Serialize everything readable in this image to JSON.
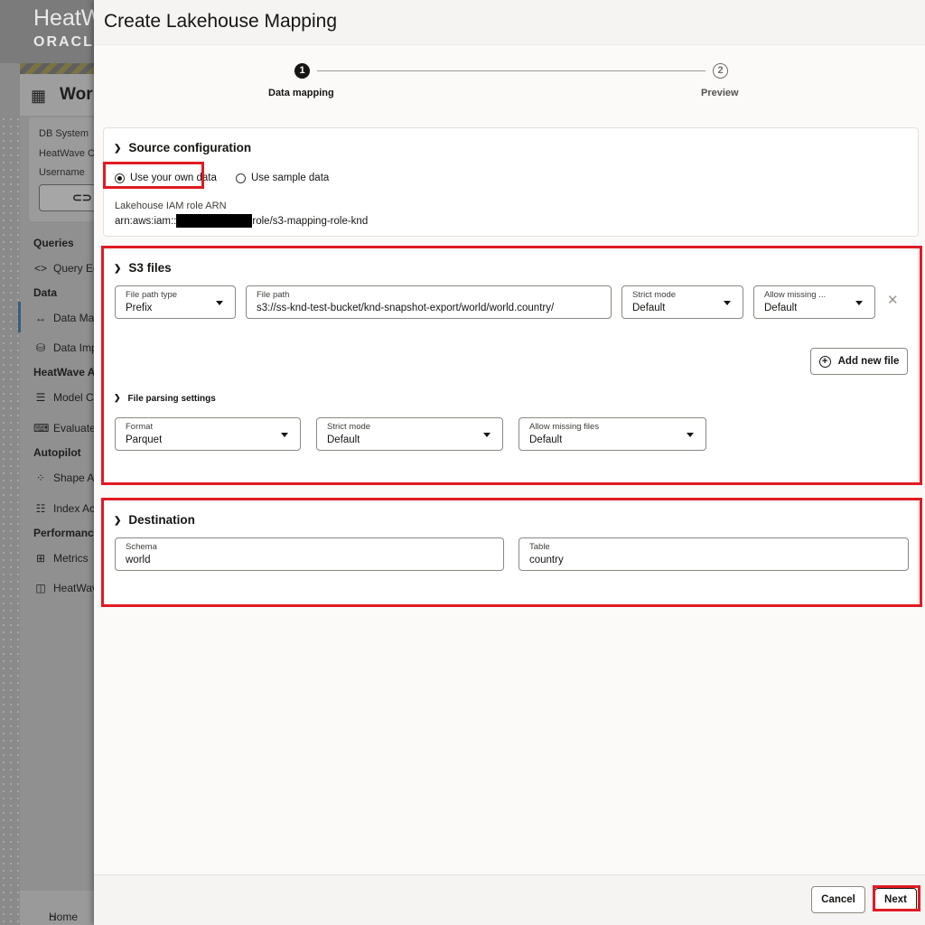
{
  "background_app": {
    "brand_line1": "HeatW",
    "brand_line2": "ORACL",
    "page_title": "Wor",
    "info_labels": [
      "DB System",
      "HeatWave C",
      "Username"
    ],
    "nav": [
      {
        "label": "Queries",
        "section": true
      },
      {
        "label": "Query Ed",
        "icon": "<>"
      },
      {
        "label": "Data",
        "section": true
      },
      {
        "label": "Data Ma",
        "icon": "↔"
      },
      {
        "label": "Data Imp",
        "icon": "⛁"
      },
      {
        "label": "HeatWave A",
        "section": true
      },
      {
        "label": "Model C",
        "icon": "☰"
      },
      {
        "label": "Evaluate",
        "icon": "⌨"
      },
      {
        "label": "Autopilot",
        "section": true
      },
      {
        "label": "Shape A",
        "icon": "⁘"
      },
      {
        "label": "Index Ac",
        "icon": "☷"
      },
      {
        "label": "Performance",
        "section": true
      },
      {
        "label": "Metrics",
        "icon": "⊞"
      },
      {
        "label": "HeatWav",
        "icon": "◫"
      }
    ],
    "home": "Home"
  },
  "drawer": {
    "title": "Create Lakehouse Mapping",
    "steps": [
      {
        "number": "1",
        "label": "Data mapping",
        "active": true
      },
      {
        "number": "2",
        "label": "Preview",
        "active": false
      }
    ],
    "source_config": {
      "title": "Source configuration",
      "options": [
        {
          "label": "Use your own data",
          "selected": true
        },
        {
          "label": "Use sample data",
          "selected": false
        }
      ],
      "iam_label": "Lakehouse IAM role ARN",
      "iam_prefix": "arn:aws:iam::",
      "iam_suffix": "role/s3-mapping-role-knd"
    },
    "s3_files": {
      "title": "S3 files",
      "file_path_type": {
        "label": "File path type",
        "value": "Prefix"
      },
      "file_path": {
        "label": "File path",
        "value": "s3://ss-knd-test-bucket/knd-snapshot-export/world/world.country/"
      },
      "strict_mode": {
        "label": "Strict mode",
        "value": "Default"
      },
      "allow_missing": {
        "label": "Allow missing ...",
        "value": "Default"
      },
      "remove_icon": "✕",
      "add_button": "Add new file",
      "parsing_title": "File parsing settings",
      "format": {
        "label": "Format",
        "value": "Parquet"
      },
      "parse_strict_mode": {
        "label": "Strict mode",
        "value": "Default"
      },
      "parse_allow_missing": {
        "label": "Allow missing files",
        "value": "Default"
      }
    },
    "destination": {
      "title": "Destination",
      "schema": {
        "label": "Schema",
        "value": "world"
      },
      "table": {
        "label": "Table",
        "value": "country"
      }
    },
    "footer": {
      "cancel": "Cancel",
      "next": "Next"
    }
  },
  "colors": {
    "highlight": "#e01b24",
    "text": "#161513"
  }
}
